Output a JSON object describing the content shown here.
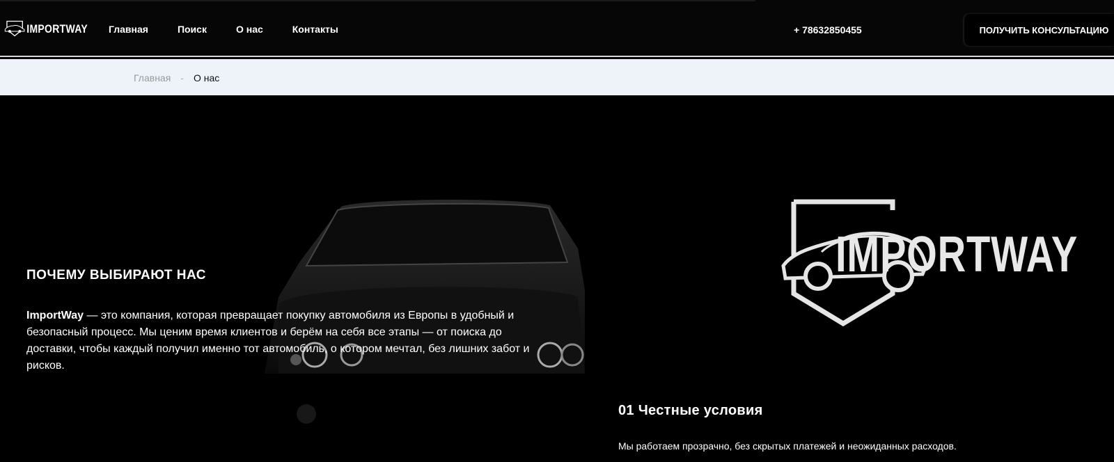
{
  "header": {
    "logo_text": "IMPORTWAY",
    "nav": [
      "Главная",
      "Поиск",
      "О нас",
      "Контакты"
    ],
    "phone": "+ 78632850455",
    "cta_label": "ПОЛУЧИТЬ КОНСУЛЬТАЦИЮ"
  },
  "breadcrumb": {
    "home": "Главная",
    "separator": "-",
    "current": "О нас"
  },
  "hero": {
    "title": "ПОЧЕМУ ВЫБИРАЮТ НАС",
    "brand_name": "ImportWay",
    "description": " — это компания, которая превращает покупку автомобиля из Европы в удобный и безопасный процесс. Мы ценим время клиентов и берём на себя все этапы — от поиска до доставки, чтобы каждый получил именно тот автомобиль, о котором мечтал, без лишних забот и рисков.",
    "logo_text": "IMPORTWAY"
  },
  "features": [
    {
      "title": "01 Честные условия",
      "text": "Мы работаем прозрачно, без скрытых платежей и неожиданных расходов."
    }
  ],
  "colors": {
    "header_bg": "#060606",
    "breadcrumb_bg": "#eef2f9",
    "hero_bg": "#000000",
    "accent_text": "#ffffff"
  }
}
